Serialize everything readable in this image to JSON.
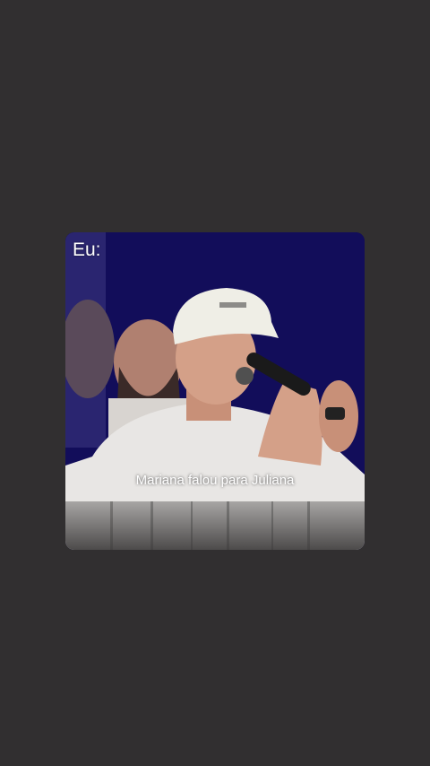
{
  "overlay_label": "Eu:",
  "caption": "Mariana falou para Juliana",
  "colors": {
    "background": "#312f30",
    "video_backdrop": "#0d0a52",
    "caption_text": "#ffffff"
  },
  "icons": [
    "microphone-icon"
  ]
}
